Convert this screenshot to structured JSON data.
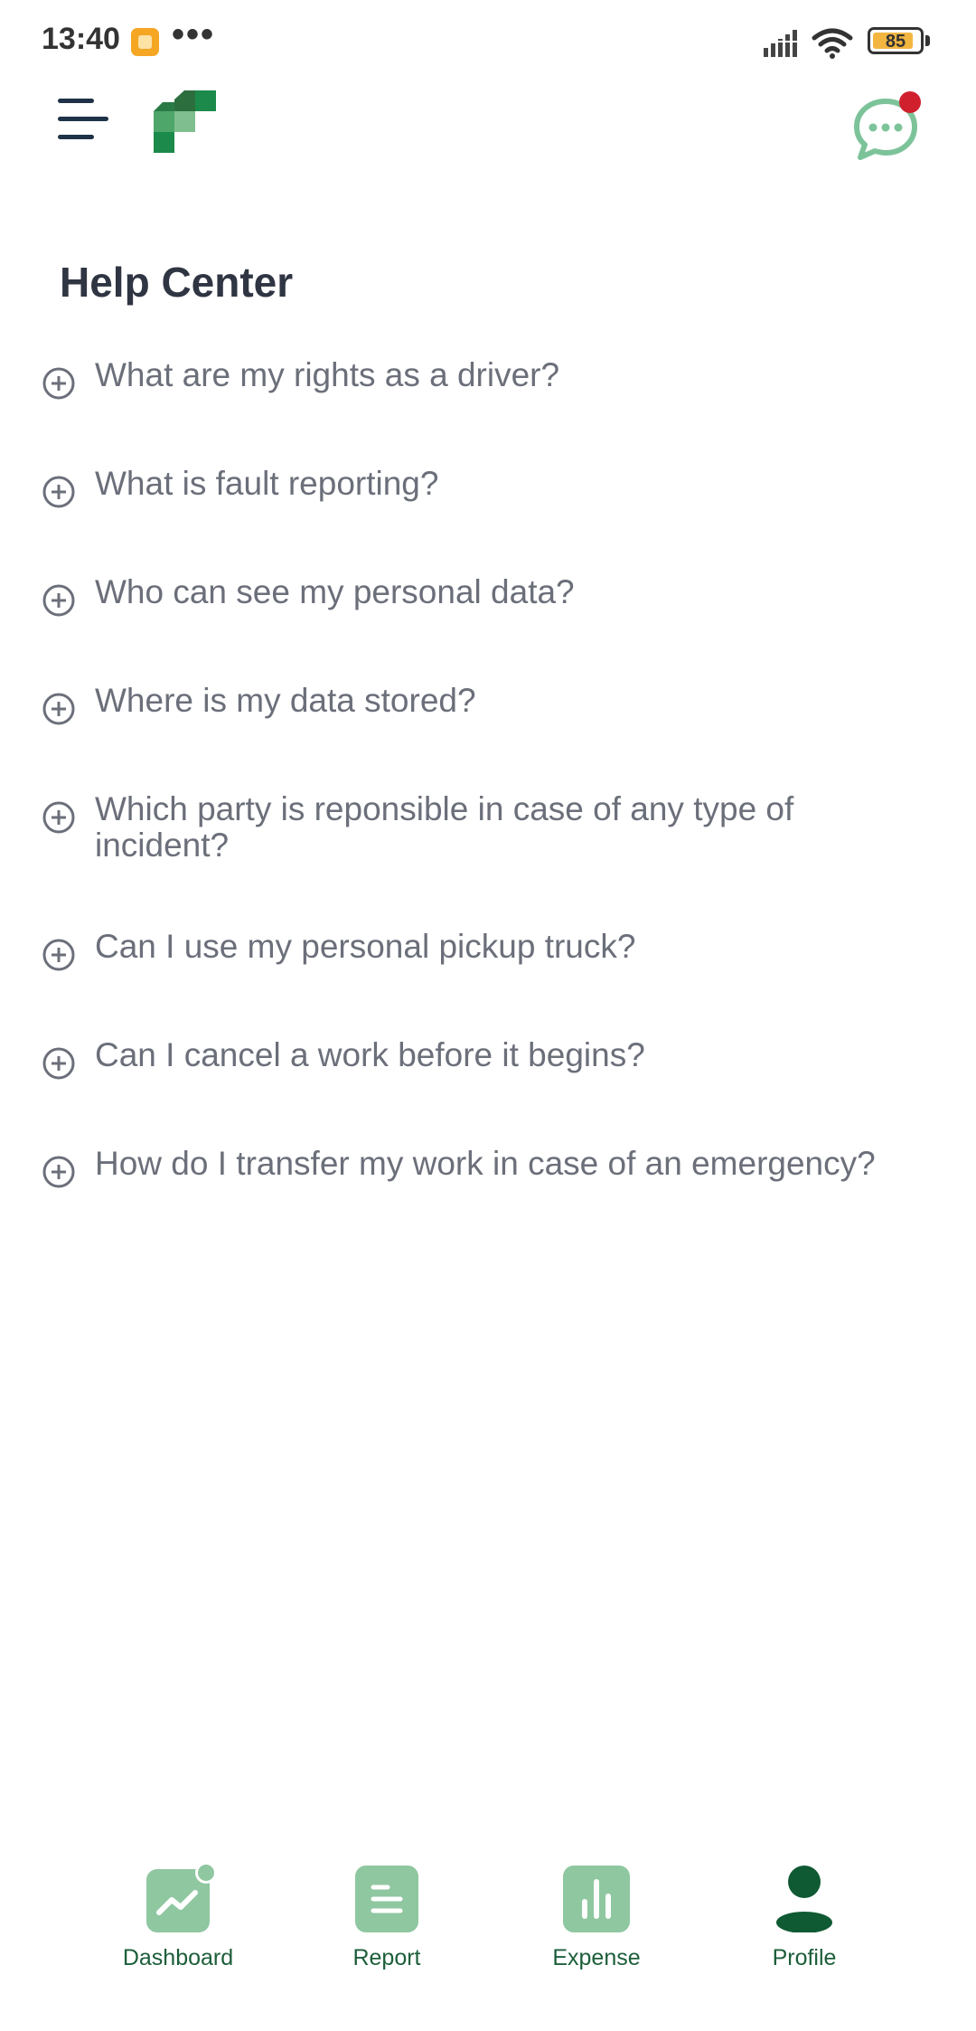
{
  "status_bar": {
    "time": "13:40",
    "dots": "•••",
    "battery": "85"
  },
  "header": {
    "menu_icon": "hamburger-menu-icon",
    "logo_icon": "green-f-logo-icon",
    "chat_icon": "chat-bubble-icon",
    "chat_has_notification": true
  },
  "page": {
    "title": "Help Center"
  },
  "faq": [
    {
      "question": "What are my rights as a driver?"
    },
    {
      "question": "What is fault reporting?"
    },
    {
      "question": "Who can see my personal data?"
    },
    {
      "question": "Where is my data stored?"
    },
    {
      "question": "Which party is reponsible in case of any type of incident?"
    },
    {
      "question": "Can I use my personal pickup truck?"
    },
    {
      "question": "Can I cancel a work before it begins?"
    },
    {
      "question": "How do I transfer my work in case of an emergency?"
    }
  ],
  "bottom_nav": {
    "items": [
      {
        "label": "Dashboard",
        "icon": "chart-trend-icon"
      },
      {
        "label": "Report",
        "icon": "document-lines-icon"
      },
      {
        "label": "Expense",
        "icon": "bar-chart-icon"
      },
      {
        "label": "Profile",
        "icon": "person-icon"
      }
    ],
    "active": "Profile"
  },
  "colors": {
    "brand_green": "#1b8a4a",
    "nav_green_light": "#8fc7a0",
    "nav_green_dark": "#0f5a33",
    "notification_red": "#d0202e",
    "title": "#2f3542",
    "faq_text": "#6b6f7a"
  }
}
